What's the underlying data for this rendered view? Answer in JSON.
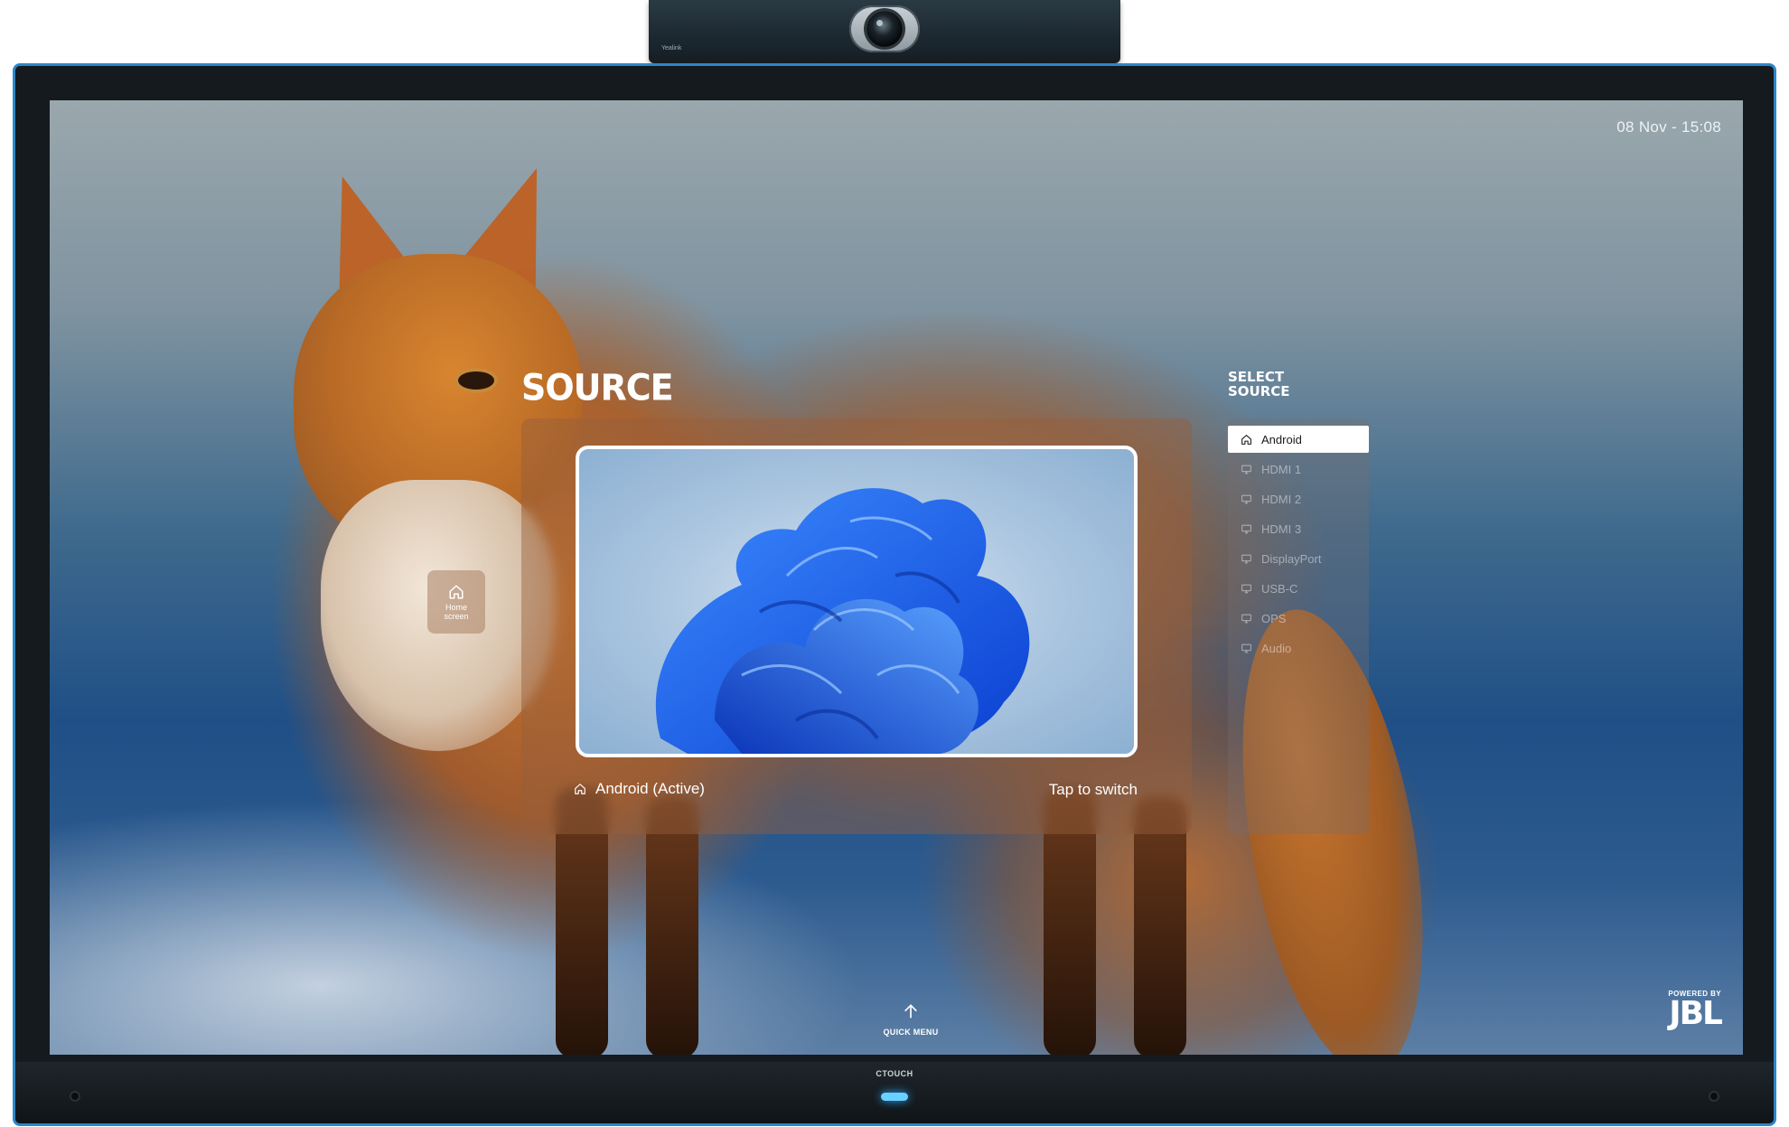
{
  "camera": {
    "brand": "Yealink"
  },
  "screen": {
    "datetime": "08 Nov - 15:08"
  },
  "source": {
    "title": "SOURCE",
    "active_label": "Android (Active)",
    "tap_label": "Tap to switch"
  },
  "home_button": {
    "label_line1": "Home",
    "label_line2": "screen",
    "icon": "home-icon"
  },
  "select_source": {
    "title_line1": "SELECT",
    "title_line2": "SOURCE",
    "items": [
      {
        "label": "Android",
        "icon": "home-icon",
        "active": true
      },
      {
        "label": "HDMI 1",
        "icon": "monitor-icon",
        "active": false
      },
      {
        "label": "HDMI 2",
        "icon": "monitor-icon",
        "active": false
      },
      {
        "label": "HDMI 3",
        "icon": "monitor-icon",
        "active": false
      },
      {
        "label": "DisplayPort",
        "icon": "monitor-icon",
        "active": false
      },
      {
        "label": "USB-C",
        "icon": "monitor-icon",
        "active": false
      },
      {
        "label": "OPS",
        "icon": "monitor-icon",
        "active": false
      },
      {
        "label": "Audio",
        "icon": "monitor-icon",
        "active": false
      }
    ]
  },
  "quick_menu": {
    "label": "QUICK MENU",
    "icon": "arrow-up-icon"
  },
  "bezel": {
    "brand": "CTOUCH"
  },
  "jbl": {
    "powered_by": "POWERED BY",
    "logo": "JBL"
  },
  "colors": {
    "frame_accent": "#2d86c8",
    "led": "#6ad0ff",
    "panel_bg": "rgba(150,96,60,.45)"
  }
}
